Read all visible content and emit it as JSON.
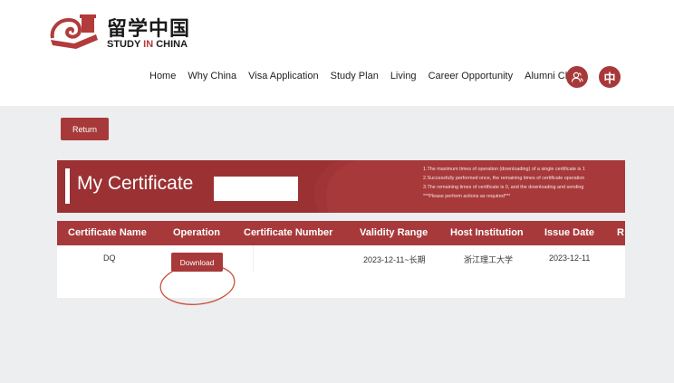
{
  "logo": {
    "cn": "留学中国",
    "en_before": "STUDY ",
    "en_accent": "IN",
    "en_after": " CHINA"
  },
  "nav": [
    "Home",
    "Why China",
    "Visa Application",
    "Study Plan",
    "Living",
    "Career Opportunity",
    "Alumni China"
  ],
  "header": {
    "lang_label": "中"
  },
  "return_label": "Return",
  "banner": {
    "title": "My Certificate",
    "notes": [
      "1.The maximum times of operation (downloading) of a single certificate is 1",
      "2.Successfully performed once, the remaining times of certificate operation",
      "3.The remaining times of certificate is 0, and the downloading and sending",
      "***Please perform actions as required***"
    ]
  },
  "table": {
    "headers": [
      "Certificate Name",
      "Operation",
      "Certificate Number",
      "Validity Range",
      "Host Institution",
      "Issue Date",
      "R"
    ],
    "row": {
      "name": "DQ",
      "download_label": "Download",
      "number": "",
      "validity": "2023-12-11~长期",
      "institution": "浙江理工大学",
      "issue_date": "2023-12-11"
    }
  },
  "colors": {
    "accent": "#a8393a",
    "background": "#eceef0"
  }
}
